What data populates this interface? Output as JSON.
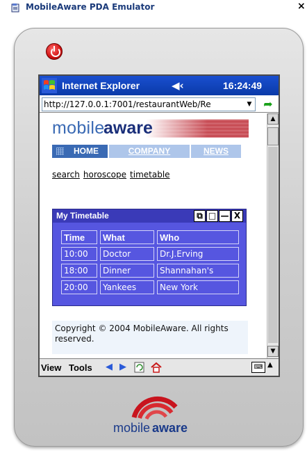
{
  "window": {
    "title": "MobileAware PDA Emulator",
    "close_label": "×"
  },
  "topbar": {
    "app_title": "Internet Explorer",
    "speaker_glyph": "◀‹",
    "clock": "16:24:49"
  },
  "address": {
    "url": "http://127.0.0.1:7001/restaurantWeb/Re"
  },
  "logo": {
    "part1": "mobile",
    "part2": "aware"
  },
  "nav": {
    "home": "HOME",
    "company": "COMPANY",
    "news": "NEWS"
  },
  "links": {
    "search": "search",
    "horoscope": "horoscope",
    "timetable": "timetable"
  },
  "timetable": {
    "title": "My Timetable",
    "headers": [
      "Time",
      "What",
      "Who"
    ],
    "rows": [
      [
        "10:00",
        "Doctor",
        "Dr.J.Erving"
      ],
      [
        "18:00",
        "Dinner",
        "Shannahan's"
      ],
      [
        "20:00",
        "Yankees",
        "New York"
      ]
    ],
    "buttons": {
      "restore": "⧉",
      "maximize": "□",
      "minimize": "—",
      "close": "X"
    }
  },
  "footer": {
    "copyright": "Copyright © 2004 MobileAware. All rights reserved."
  },
  "menubar": {
    "view": "View",
    "tools": "Tools"
  },
  "bottom_logo": {
    "part1": "mobile",
    "part2": "aware"
  },
  "colors": {
    "brand_blue": "#3a6ab4",
    "widget_blue": "#5656e0",
    "topbar_blue": "#0a3aa8",
    "brand_red": "#c8141e"
  }
}
